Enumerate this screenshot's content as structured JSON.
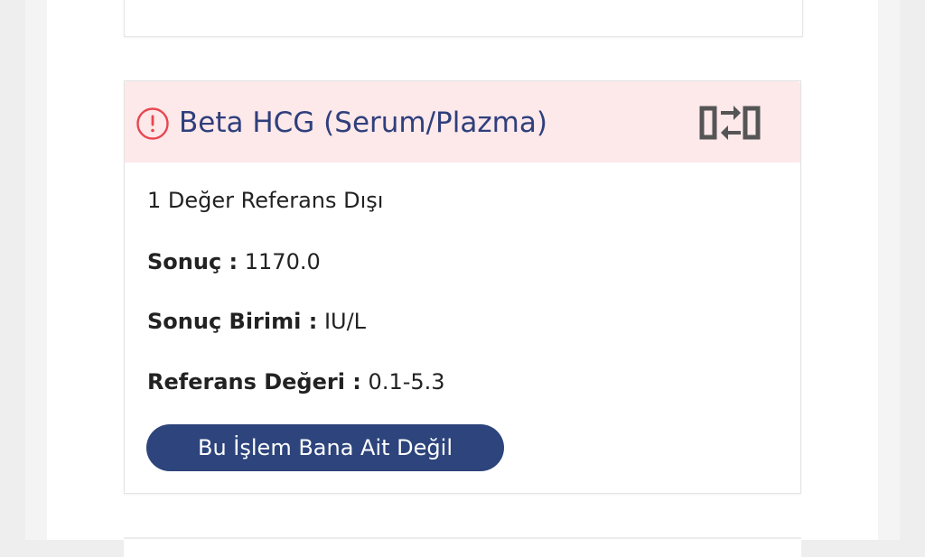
{
  "card": {
    "title": "Beta HCG (Serum/Plazma)",
    "status_text": "1 Değer Referans Dışı",
    "fields": [
      {
        "label": "Sonuç :",
        "value": "1170.0"
      },
      {
        "label": "Sonuç Birimi :",
        "value": "IU/L"
      },
      {
        "label": "Referans Değeri :",
        "value": "0.1-5.3"
      }
    ],
    "action_label": "Bu İşlem Bana Ait Değil",
    "icons": {
      "alert": "exclamation-circle-icon",
      "swap": "swap-horizontal-icon"
    }
  },
  "colors": {
    "header_bg": "#fde8ea",
    "alert_red": "#e8474f",
    "title_blue": "#2e3f7c",
    "button_bg": "#2d447c",
    "icon_gray": "#555555"
  }
}
